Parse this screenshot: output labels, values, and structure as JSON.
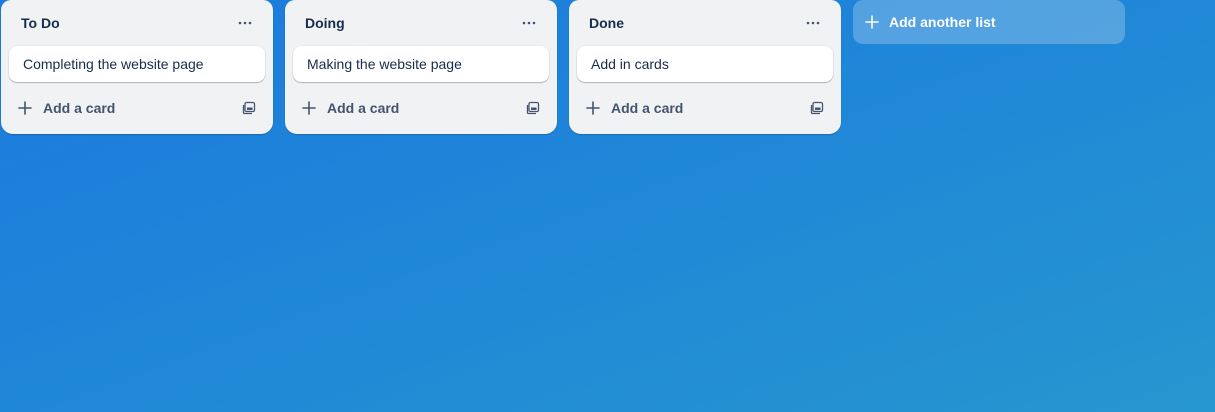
{
  "board": {
    "lists": [
      {
        "title": "To Do",
        "cards": [
          "Completing the website page"
        ],
        "add_card_label": "Add a card"
      },
      {
        "title": "Doing",
        "cards": [
          "Making the website page"
        ],
        "add_card_label": "Add a card"
      },
      {
        "title": "Done",
        "cards": [
          "Add in cards"
        ],
        "add_card_label": "Add a card"
      }
    ],
    "add_list_label": "Add another list"
  },
  "icons": {
    "list_menu": "more-horizontal-icon",
    "add": "plus-icon",
    "template": "card-template-icon"
  },
  "colors": {
    "background_start": "#1d79de",
    "background_end": "#2696cf",
    "list_bg": "#f1f2f4",
    "text_primary": "#172b4d",
    "text_secondary": "#44546f"
  }
}
